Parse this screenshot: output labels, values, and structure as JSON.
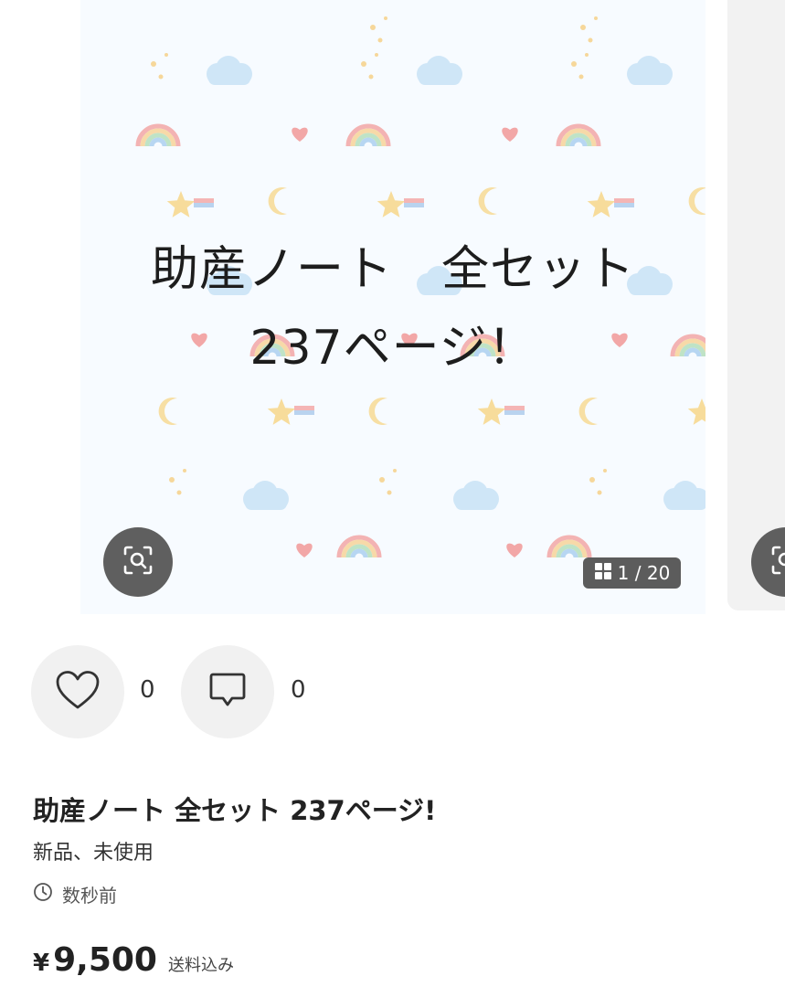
{
  "image": {
    "line1": "助産ノート　全セット",
    "line2": "237ページ！",
    "counter": "1 / 20"
  },
  "actions": {
    "like_count": "0",
    "comment_count": "0"
  },
  "item": {
    "title": "助産ノート 全セット 237ページ!",
    "condition": "新品、未使用",
    "posted": "数秒前",
    "currency": "¥",
    "price": "9,500",
    "shipping": "送料込み"
  },
  "icons": {
    "lens": "visual-search-icon",
    "grid": "grid-icon",
    "heart": "heart-icon",
    "comment": "comment-icon",
    "clock": "clock-icon"
  },
  "colors": {
    "overlay_button": "#5f5f5f",
    "action_bg": "#f1f1f1",
    "text": "#222222"
  }
}
